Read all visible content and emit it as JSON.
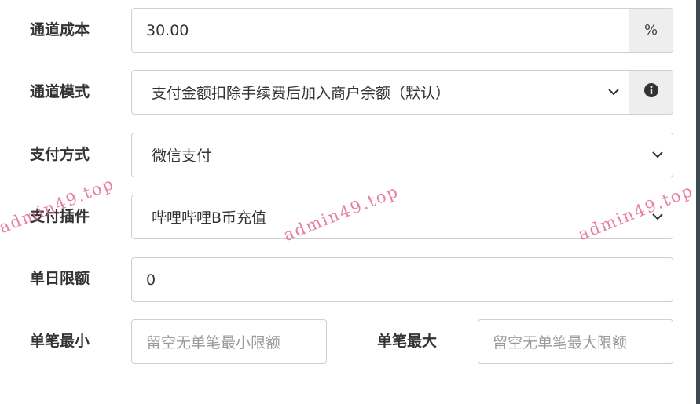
{
  "form": {
    "channel_cost": {
      "label": "通道成本",
      "value": "30.00",
      "suffix": "%"
    },
    "channel_mode": {
      "label": "通道模式",
      "selected": "支付金额扣除手续费后加入商户余额（默认）",
      "info_icon": "info-circle-icon"
    },
    "pay_method": {
      "label": "支付方式",
      "selected": "微信支付"
    },
    "pay_plugin": {
      "label": "支付插件",
      "selected": "哔哩哔哩B币充值"
    },
    "daily_limit": {
      "label": "单日限额",
      "value": "0"
    },
    "single_min": {
      "label": "单笔最小",
      "placeholder": "留空无单笔最小限额"
    },
    "single_max": {
      "label": "单笔最大",
      "placeholder": "留空无单笔最大限额"
    }
  },
  "watermark": {
    "text": "admin49.top"
  },
  "icons": {
    "dropdown": "chevron-down-icon"
  },
  "colors": {
    "watermark": "#e36b8f",
    "addon_bg": "#eeeeee",
    "border": "#cfcfcf"
  }
}
